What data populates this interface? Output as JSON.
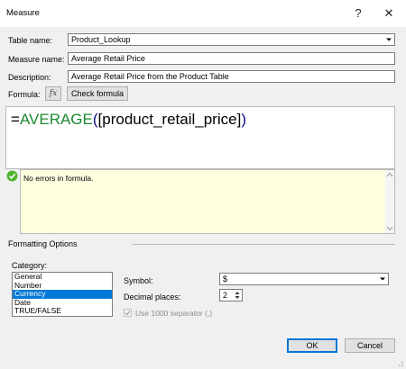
{
  "window": {
    "title": "Measure",
    "help_label": "?",
    "close_label": "✕"
  },
  "fields": {
    "table_name_label": "Table name:",
    "table_name_value": "Product_Lookup",
    "measure_name_label": "Measure name:",
    "measure_name_value": "Average Retail Price",
    "description_label": "Description:",
    "description_value": "Average Retail Price from the Product Table"
  },
  "formula": {
    "label": "Formula:",
    "fx_label": "fx",
    "check_button": "Check formula",
    "eq": "=",
    "func": "AVERAGE",
    "open": "(",
    "arg": "[product_retail_price]",
    "close": ")"
  },
  "status": {
    "message": "No errors in formula."
  },
  "formatting": {
    "section_label": "Formatting Options",
    "category_label": "Category:",
    "categories": [
      "General",
      "Number",
      "Currency",
      "Date",
      "TRUE/FALSE"
    ],
    "selected_category": "Currency",
    "symbol_label": "Symbol:",
    "symbol_value": "$",
    "decimal_label": "Decimal places:",
    "decimal_value": "2",
    "separator_label": "Use 1000 separator (,)",
    "separator_checked": true
  },
  "buttons": {
    "ok": "OK",
    "cancel": "Cancel"
  },
  "colors": {
    "accent": "#0078d7",
    "formula_func": "#1c8a30",
    "status_ok": "#4fb530",
    "message_bg": "#ffffe0"
  }
}
